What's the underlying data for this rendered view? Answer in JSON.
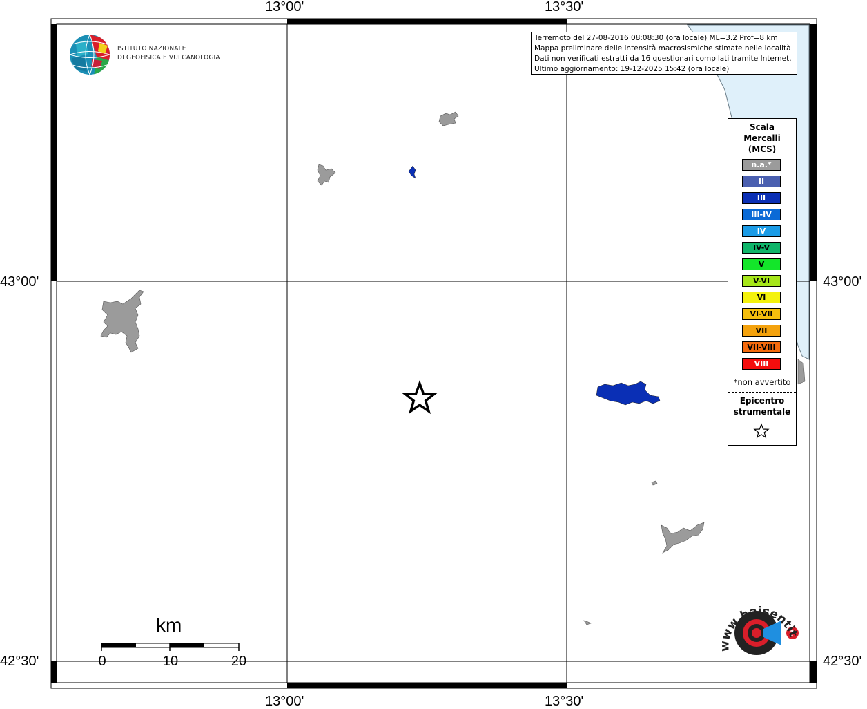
{
  "map": {
    "lon_labels": [
      "13°00'",
      "13°30'"
    ],
    "lat_labels": [
      "43°00'",
      "42°30'"
    ]
  },
  "logo": {
    "line1": "ISTITUTO NAZIONALE",
    "line2": "DI GEOFISICA E VULCANOLOGIA"
  },
  "info": {
    "line1": "Terremoto del 27-08-2016 08:08:30 (ora locale) ML=3.2 Prof=8 km",
    "line2": "Mappa preliminare delle intensità macrosismiche stimate nelle località",
    "line3": "Dati non verificati estratti da 16 questionari compilati tramite Internet.",
    "line4": "Ultimo aggiornamento: 19-12-2025 15:42 (ora locale)"
  },
  "legend": {
    "title_line1": "Scala",
    "title_line2": "Mercalli",
    "title_line3": "(MCS)",
    "items": [
      {
        "label": "n.a.*",
        "color": "#9b9b9b",
        "text_color": "#ffffff"
      },
      {
        "label": "II",
        "color": "#4a5fb0",
        "text_color": "#ffffff"
      },
      {
        "label": "III",
        "color": "#0a2fb5",
        "text_color": "#ffffff"
      },
      {
        "label": "III-IV",
        "color": "#0a6ad6",
        "text_color": "#ffffff"
      },
      {
        "label": "IV",
        "color": "#1a9be6",
        "text_color": "#ffffff"
      },
      {
        "label": "IV-V",
        "color": "#0fb56a",
        "text_color": "#000000"
      },
      {
        "label": "V",
        "color": "#13e62a",
        "text_color": "#000000"
      },
      {
        "label": "V-VI",
        "color": "#a6e61a",
        "text_color": "#000000"
      },
      {
        "label": "VI",
        "color": "#f4f20d",
        "text_color": "#000000"
      },
      {
        "label": "VI-VII",
        "color": "#f4be0d",
        "text_color": "#000000"
      },
      {
        "label": "VII",
        "color": "#f4a20d",
        "text_color": "#000000"
      },
      {
        "label": "VII-VIII",
        "color": "#f46a0d",
        "text_color": "#000000"
      },
      {
        "label": "VIII",
        "color": "#f40d0d",
        "text_color": "#ffffff"
      }
    ],
    "note": "*non avvertito",
    "epicenter_line1": "Epicentro",
    "epicenter_line2": "strumentale"
  },
  "scalebar": {
    "unit": "km",
    "ticks": [
      "0",
      "10",
      "20"
    ]
  },
  "colors": {
    "sea": "#dff0fa",
    "place_na": "#9b9b9b",
    "place_iii": "#0a2fb5"
  },
  "watermark_text": "www.haisentitoilterremoto.it"
}
